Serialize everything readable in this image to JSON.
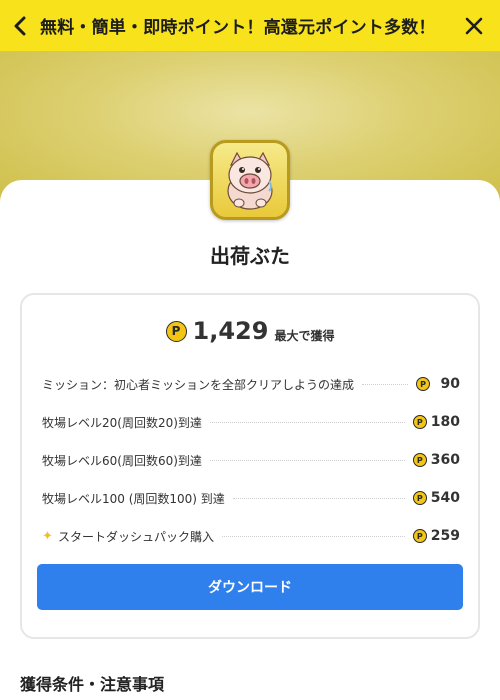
{
  "header": {
    "title": "無料・簡単・即時ポイント！高還元ポイント多数！"
  },
  "app": {
    "name": "出荷ぶた"
  },
  "reward": {
    "total": "1,429",
    "total_suffix": "最大で獲得",
    "coin_symbol": "P"
  },
  "missions": [
    {
      "label": "ミッション：初心者ミッションを全部クリアしようの達成",
      "points": "90",
      "special": false
    },
    {
      "label": "牧場レベル20(周回数20)到達",
      "points": "180",
      "special": false
    },
    {
      "label": "牧場レベル60(周回数60)到達",
      "points": "360",
      "special": false
    },
    {
      "label": "牧場レベル100 (周回数100) 到達",
      "points": "540",
      "special": false
    },
    {
      "label": "スタートダッシュパック購入",
      "points": "259",
      "special": true
    }
  ],
  "download_button": "ダウンロード",
  "conditions_title": "獲得条件・注意事項",
  "colors": {
    "header_bg": "#f7e21c",
    "accent_blue": "#2f80ed",
    "coin_yellow": "#f4c614"
  }
}
